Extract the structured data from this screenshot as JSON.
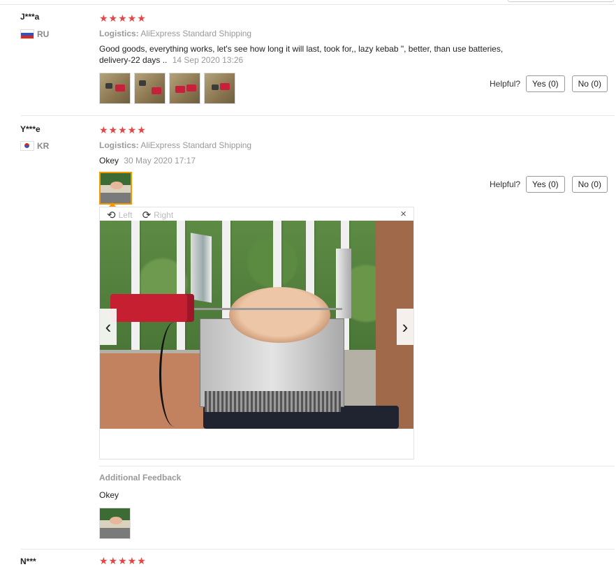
{
  "reviews": [
    {
      "user": "J***a",
      "country": "RU",
      "stars": "★★★★★",
      "logistics_label": "Logistics:",
      "logistics_value": "AliExpress Standard Shipping",
      "text_line1": "Good goods, everything works, let's see how long it will last, took for,, lazy kebab \", better, than use batteries,",
      "text_line2": "delivery-22 days ..",
      "date": "14 Sep 2020 13:26",
      "helpful_label": "Helpful?",
      "yes_label": "Yes (0)",
      "no_label": "No (0)"
    },
    {
      "user": "Y***e",
      "country": "KR",
      "stars": "★★★★★",
      "logistics_label": "Logistics:",
      "logistics_value": "AliExpress Standard Shipping",
      "text": "Okey",
      "date": "30 May 2020 17:17",
      "helpful_label": "Helpful?",
      "yes_label": "Yes (0)",
      "no_label": "No (0)",
      "viewer": {
        "rotate_left": "Left",
        "rotate_right": "Right",
        "close": "×",
        "prev": "‹",
        "next": "›"
      },
      "additional_title": "Additional Feedback",
      "additional_text": "Okey"
    }
  ],
  "next_review": {
    "user": "N***",
    "stars": "★★★★★"
  },
  "colors": {
    "stars": "#e64545",
    "active_thumb": "#f39800"
  }
}
